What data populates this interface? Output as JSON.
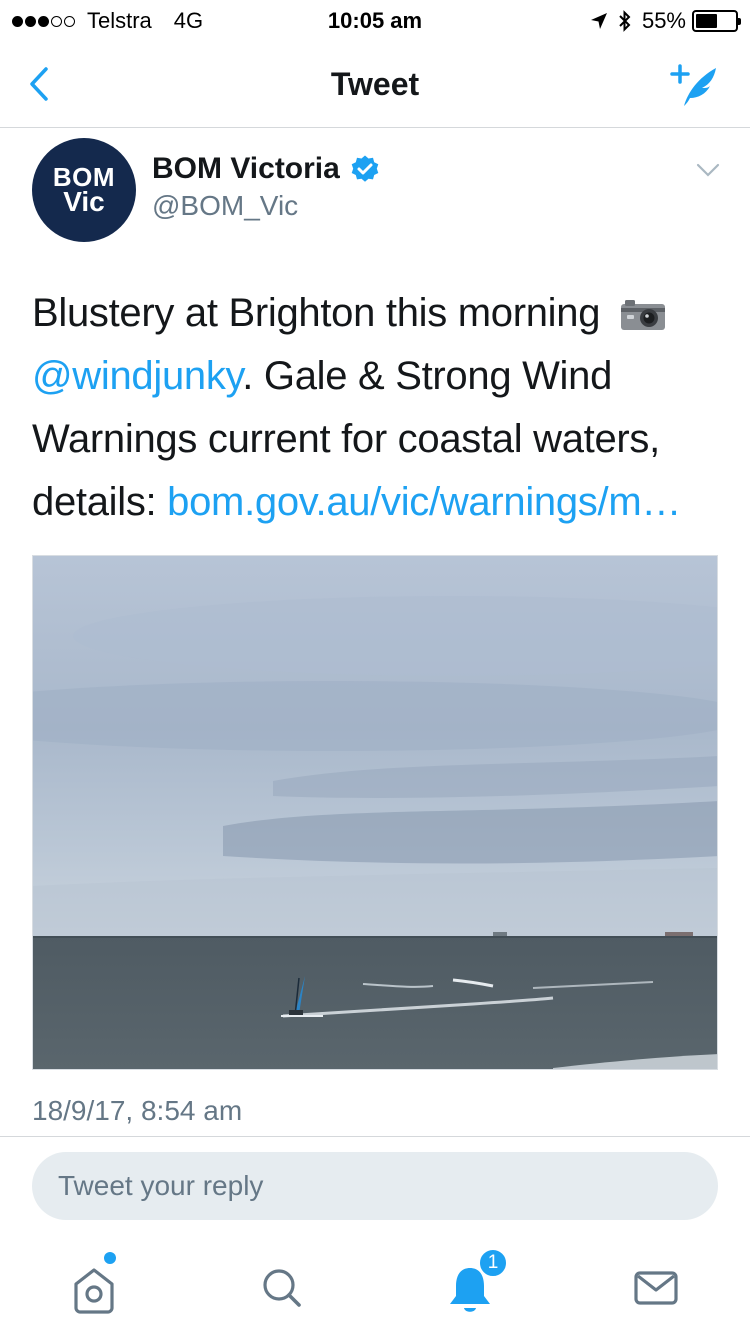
{
  "status_bar": {
    "signal_bars": 3,
    "signal_total": 5,
    "carrier": "Telstra",
    "network": "4G",
    "time": "10:05 am",
    "battery_text": "55%",
    "battery_level": 0.55,
    "icons": [
      "location-arrow-icon",
      "bluetooth-icon",
      "battery-icon"
    ]
  },
  "nav": {
    "title": "Tweet",
    "back_icon": "chevron-left-icon",
    "compose_icon": "compose-tweet-icon"
  },
  "author": {
    "avatar_line1": "BOM",
    "avatar_line2": "Vic",
    "name": "BOM Victoria",
    "handle": "@BOM_Vic",
    "verified": true
  },
  "tweet": {
    "text_part1": "Blustery at Brighton this morning",
    "mention": "@windjunky",
    "text_part2": ". Gale & Strong Wind Warnings current for coastal waters, details: ",
    "link": "bom.gov.au/vic/warnings/m…",
    "timestamp": "18/9/17, 8:54 am"
  },
  "reply": {
    "placeholder": "Tweet your reply"
  },
  "tabbar": {
    "home_icon": "home-icon",
    "search_icon": "search-icon",
    "notifications_icon": "bell-icon",
    "notifications_badge": "1",
    "messages_icon": "envelope-icon"
  },
  "colors": {
    "accent": "#1da1f2",
    "avatar_bg": "#14294d",
    "secondary_text": "#657786"
  }
}
